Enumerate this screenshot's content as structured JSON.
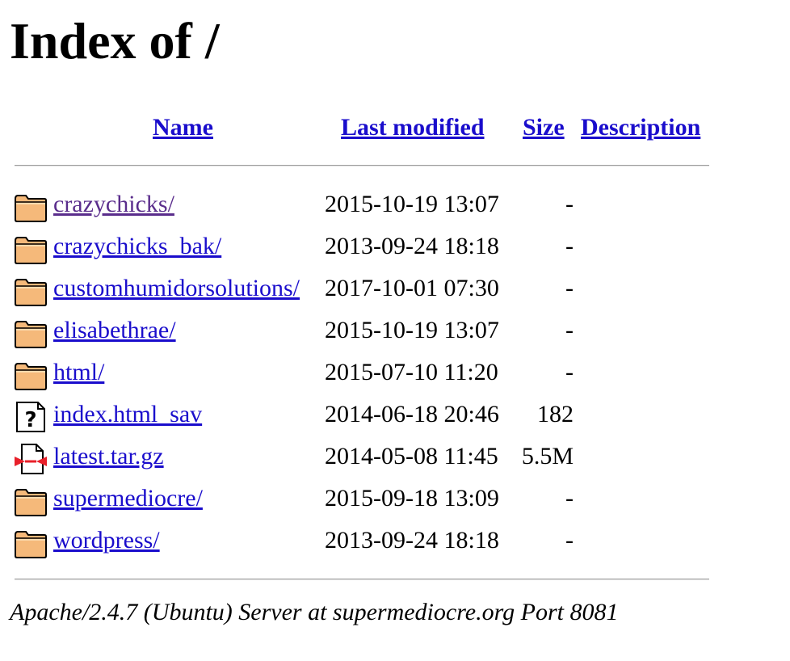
{
  "page_title": "Index of /",
  "columns": {
    "name": "Name",
    "last_modified": "Last modified",
    "size": "Size",
    "description": "Description"
  },
  "entries": [
    {
      "name": "crazychicks/",
      "modified": "2015-10-19 13:07",
      "size": "-",
      "description": "",
      "icon": "folder-icon",
      "visited": true
    },
    {
      "name": "crazychicks_bak/",
      "modified": "2013-09-24 18:18",
      "size": "-",
      "description": "",
      "icon": "folder-icon",
      "visited": false
    },
    {
      "name": "customhumidorsolutions/",
      "modified": "2017-10-01 07:30",
      "size": "-",
      "description": "",
      "icon": "folder-icon",
      "visited": false
    },
    {
      "name": "elisabethrae/",
      "modified": "2015-10-19 13:07",
      "size": "-",
      "description": "",
      "icon": "folder-icon",
      "visited": false
    },
    {
      "name": "html/",
      "modified": "2015-07-10 11:20",
      "size": "-",
      "description": "",
      "icon": "folder-icon",
      "visited": false
    },
    {
      "name": "index.html_sav",
      "modified": "2014-06-18 20:46",
      "size": "182",
      "description": "",
      "icon": "unknown-file-icon",
      "visited": false
    },
    {
      "name": "latest.tar.gz",
      "modified": "2014-05-08 11:45",
      "size": "5.5M",
      "description": "",
      "icon": "compressed-file-icon",
      "visited": false
    },
    {
      "name": "supermediocre/",
      "modified": "2015-09-18 13:09",
      "size": "-",
      "description": "",
      "icon": "folder-icon",
      "visited": false
    },
    {
      "name": "wordpress/",
      "modified": "2013-09-24 18:18",
      "size": "-",
      "description": "",
      "icon": "folder-icon",
      "visited": false
    }
  ],
  "footer": "Apache/2.4.7 (Ubuntu) Server at supermediocre.org Port 8081",
  "colors": {
    "link": "#1a0dcc",
    "visited_link": "#5a2d8c",
    "folder_fill": "#f5b97a",
    "folder_outline": "#000000",
    "archive_accent": "#e8202a"
  }
}
